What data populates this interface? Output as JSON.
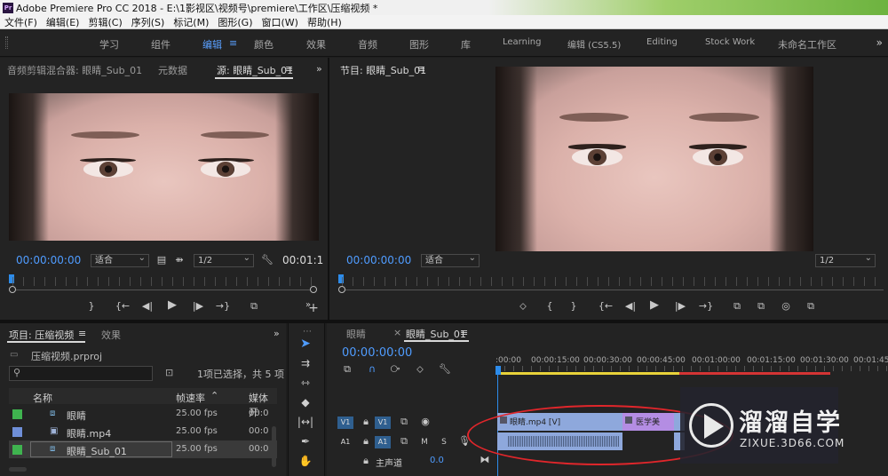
{
  "window": {
    "title": "Adobe Premiere Pro CC 2018 - E:\\1影视区\\视频号\\premiere\\工作区\\压缩视频 *",
    "app_icon": "Pr"
  },
  "menu": [
    "文件(F)",
    "编辑(E)",
    "剪辑(C)",
    "序列(S)",
    "标记(M)",
    "图形(G)",
    "窗口(W)",
    "帮助(H)"
  ],
  "workspaces": {
    "items": [
      "学习",
      "组件",
      "编辑",
      "颜色",
      "效果",
      "音频",
      "图形",
      "库",
      "Learning",
      "编辑 (CS5.5)",
      "Editing",
      "Stock Work",
      "未命名工作区"
    ],
    "active_index": 2,
    "menu_glyph": "≡",
    "more_glyph": "»"
  },
  "source_panel": {
    "tabs": [
      "音频剪辑混合器: 眼睛_Sub_01",
      "元数据",
      "源: 眼睛_Sub_01"
    ],
    "active_tab_index": 2,
    "menu_glyph": "≡",
    "more_glyph": "»",
    "timecode": "00:00:00:00",
    "fit": "适合",
    "resolution": "1/2",
    "duration": "00:01:1",
    "controls": [
      "}",
      "{←",
      "◀|",
      "▶",
      "|▶",
      "→}",
      "⧉"
    ],
    "add_glyph": "+"
  },
  "program_panel": {
    "title": "节目: 眼睛_Sub_01",
    "menu_glyph": "≡",
    "timecode": "00:00:00:00",
    "fit": "适合",
    "resolution": "1/2",
    "controls": [
      "⬦",
      "{",
      "}",
      "{←",
      "◀|",
      "▶",
      "|▶",
      "→}",
      "⧉",
      "⧉",
      "◎",
      "⧉"
    ]
  },
  "project_panel": {
    "tabs": [
      "项目: 压缩视频",
      "效果"
    ],
    "menu_glyph": "≡",
    "more_glyph": "»",
    "file": "压缩视频.prproj",
    "selection_info": "1项已选择，共 5 项",
    "columns": [
      "名称",
      "帧速率",
      "媒体开"
    ],
    "rows": [
      {
        "name": "眼睛",
        "rate": "25.00 fps",
        "media": "00:0",
        "color": "#3fb34f",
        "icon": "sequence-icon"
      },
      {
        "name": "眼睛.mp4",
        "rate": "25.00 fps",
        "media": "00:0",
        "color": "#6f8fd8",
        "icon": "clip-icon"
      },
      {
        "name": "眼睛_Sub_01",
        "rate": "25.00 fps",
        "media": "00:0",
        "color": "#3fb34f",
        "icon": "sequence-icon"
      }
    ]
  },
  "timeline": {
    "tabs": [
      "眼睛",
      "眼睛_Sub_01"
    ],
    "active_tab_index": 1,
    "close_glyph": "×",
    "menu_glyph": "≡",
    "timecode": "00:00:00:00",
    "ruler_labels": [
      ":00:00",
      "00:00:15:00",
      "00:00:30:00",
      "00:00:45:00",
      "00:01:00:00",
      "00:01:15:00",
      "00:01:30:00",
      "00:01:45:0"
    ],
    "tracks": {
      "video": {
        "src": "V1",
        "target": "V1"
      },
      "audio": {
        "src": "A1",
        "target": "A1",
        "m": "M",
        "s": "S"
      },
      "master": {
        "label": "主声道",
        "value": "0.0"
      }
    },
    "clips": {
      "video_1": "眼睛.mp4 [V]",
      "video_2": "医学美"
    }
  },
  "watermark": {
    "title": "溜溜自学",
    "url": "ZIXUE.3D66.COM"
  },
  "colors": {
    "accent": "#4f9cff",
    "annotation": "#e0262b",
    "clip_video": "#8ea8dc",
    "clip_purple": "#b48de3"
  }
}
